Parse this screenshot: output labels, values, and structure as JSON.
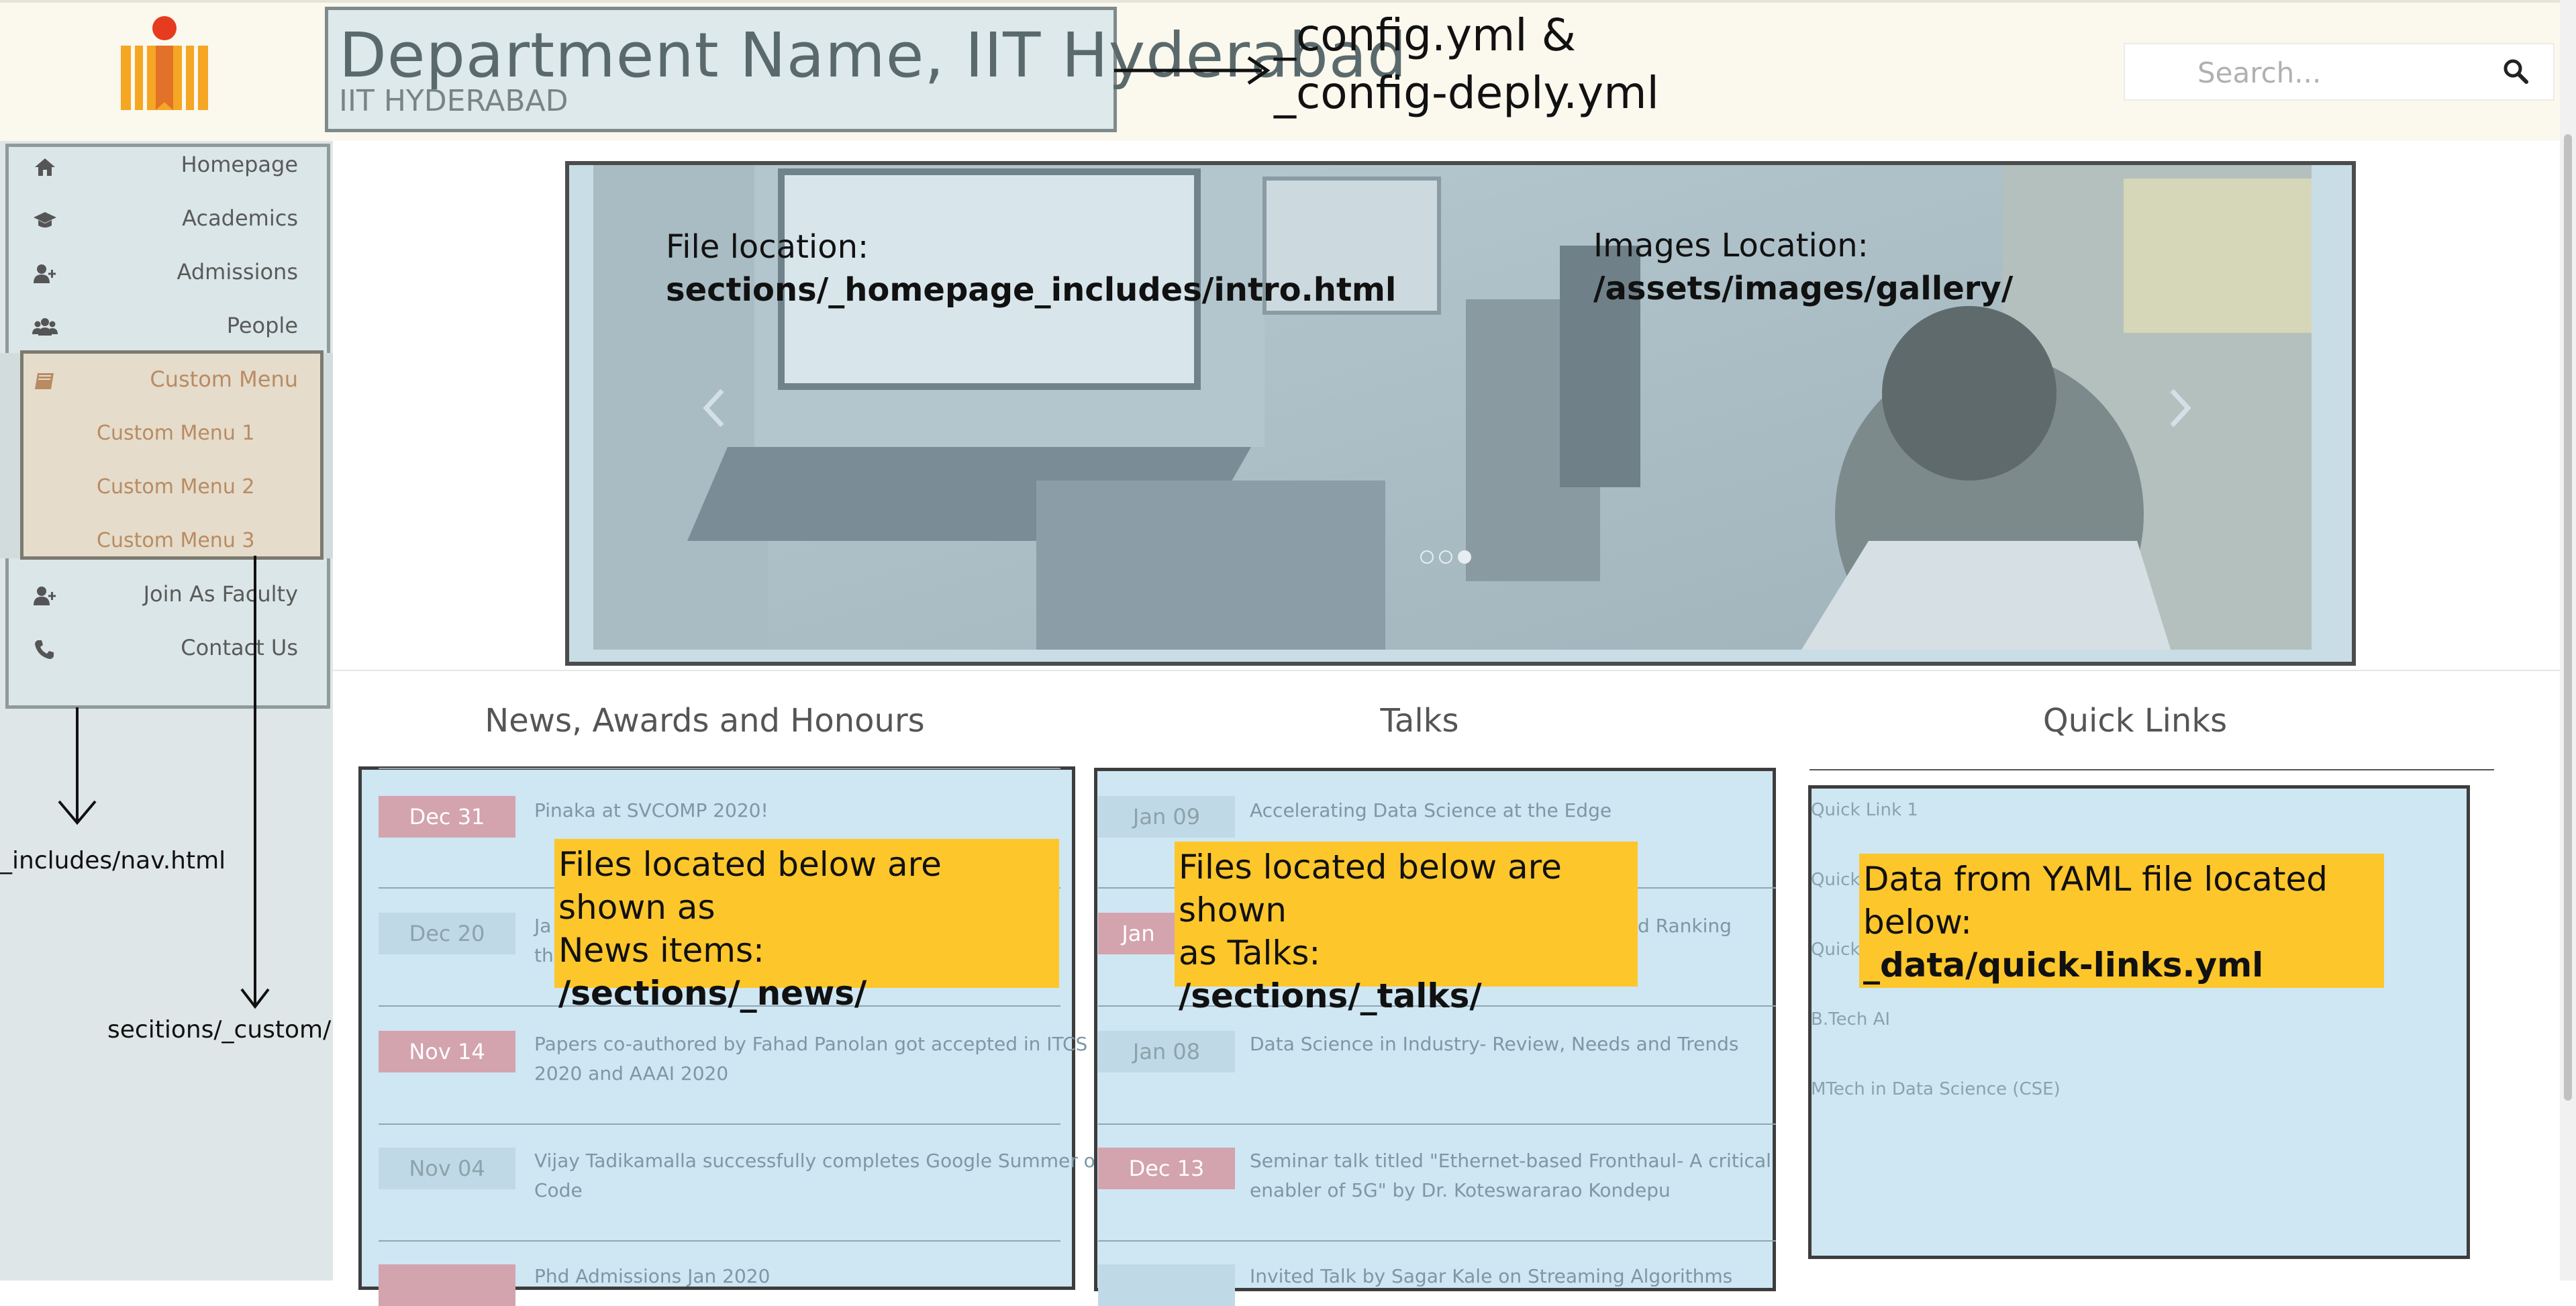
{
  "header": {
    "site_title": "Department Name, IIT Hyderabad",
    "site_subtitle": "IIT HYDERABAD",
    "config_note_line1": "_config.yml &",
    "config_note_line2": "_config-deply.yml",
    "search_placeholder": "Search..."
  },
  "nav": {
    "items": [
      {
        "label": "Homepage",
        "icon": "home-icon"
      },
      {
        "label": "Academics",
        "icon": "graduation-cap-icon"
      },
      {
        "label": "Admissions",
        "icon": "user-plus-icon"
      },
      {
        "label": "People",
        "icon": "users-icon"
      },
      {
        "label": "Custom Menu",
        "icon": "book-icon"
      },
      {
        "label": "Join As Faculty",
        "icon": "user-plus-icon"
      },
      {
        "label": "Contact Us",
        "icon": "phone-icon"
      }
    ],
    "custom_sub": [
      "Custom Menu 1",
      "Custom Menu 2",
      "Custom Menu 3"
    ],
    "nav_annotation": "_includes/nav.html",
    "custom_annotation": "secitions/_custom/"
  },
  "carousel": {
    "file_label": "File location:",
    "file_path": "sections/_homepage_includes/intro.html",
    "images_label": "Images Location:",
    "images_path": "/assets/images/gallery/",
    "prev_icon": "chevron-left-icon",
    "next_icon": "chevron-right-icon"
  },
  "news": {
    "heading": "News, Awards and Honours",
    "items": [
      {
        "date": "Dec 31",
        "text": "Pinaka at SVCOMP 2020!",
        "style": "red"
      },
      {
        "date": "Dec 20",
        "text": "Ja",
        "text2": "th",
        "style": "blue"
      },
      {
        "date": "Nov 14",
        "text": "Papers co-authored by Fahad Panolan got accepted in ITCS",
        "text2": "2020 and AAAI 2020",
        "style": "red"
      },
      {
        "date": "Nov 04",
        "text": "Vijay Tadikamalla successfully completes Google Summer of",
        "text2": "Code",
        "style": "blue"
      },
      {
        "date": "",
        "text": "Phd Admissions Jan 2020",
        "style": "red"
      }
    ],
    "note_line1": "Files located below are shown as",
    "note_line2": "News items:",
    "note_path": "/sections/_news/"
  },
  "talks": {
    "heading": "Talks",
    "items": [
      {
        "date": "Jan 09",
        "text": "Accelerating Data Science at the Edge",
        "style": "blue"
      },
      {
        "date": "Jan",
        "text": "d Ranking",
        "style": "red"
      },
      {
        "date": "Jan 08",
        "text": "Data Science in Industry- Review, Needs and Trends",
        "style": "blue"
      },
      {
        "date": "Dec 13",
        "text": "Seminar talk titled \"Ethernet-based Fronthaul- A critical",
        "text2": "enabler of 5G\" by Dr. Koteswararao Kondepu",
        "style": "red"
      },
      {
        "date": "",
        "text": "Invited Talk by Sagar Kale on Streaming Algorithms",
        "style": "blue"
      }
    ],
    "note_line1": "Files located below are shown",
    "note_line2": "as Talks:",
    "note_path": "/sections/_talks/"
  },
  "quicklinks": {
    "heading": "Quick Links",
    "items": [
      "Quick Link 1",
      "Quick",
      "Quick",
      "B.Tech AI",
      "MTech in Data Science (CSE)"
    ],
    "note_line1": "Data from YAML file located below:",
    "note_path": "_data/quick-links.yml"
  },
  "colors": {
    "header_bg": "#fbf8ee",
    "sidebar_bg": "#dfe6e7",
    "note_yellow": "#fdc62b",
    "date_red": "#d3a3ae",
    "date_blue": "#bfdae6",
    "logo_orange": "#f5a623",
    "logo_red": "#e63b1e"
  }
}
